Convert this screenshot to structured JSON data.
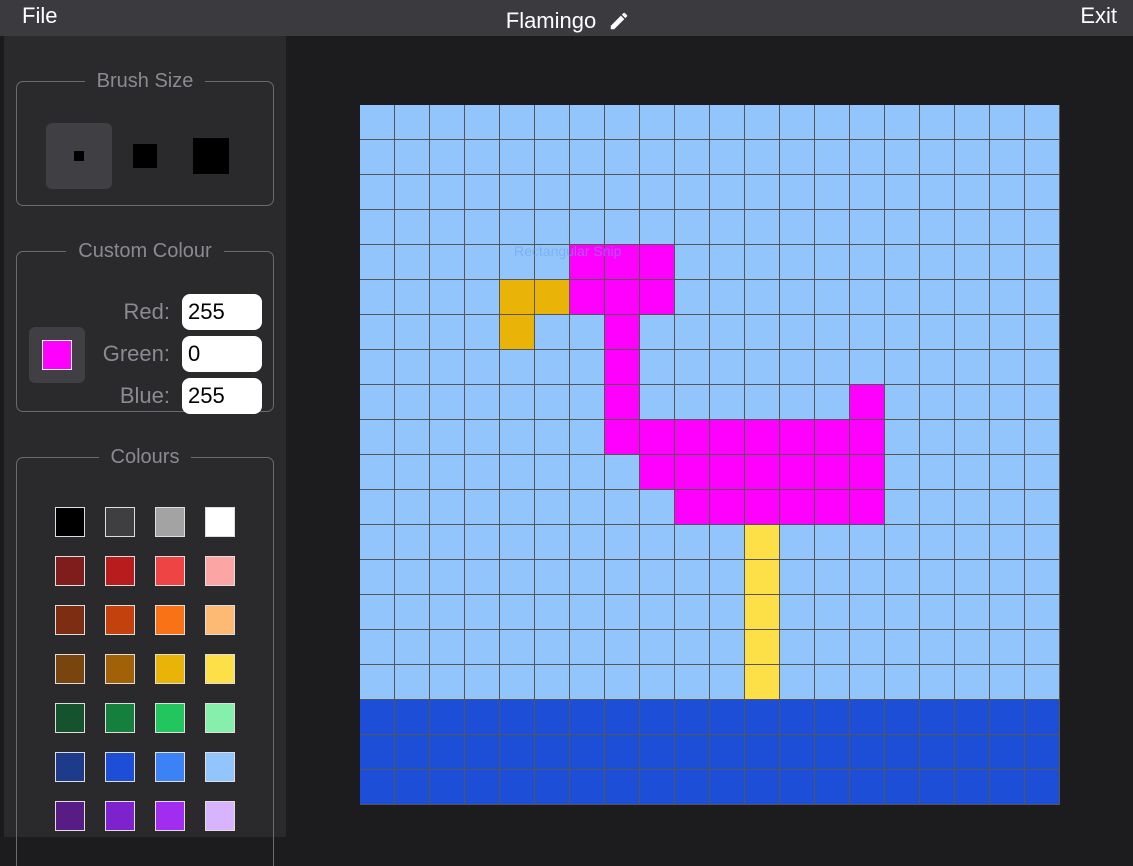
{
  "topbar": {
    "file_label": "File",
    "exit_label": "Exit",
    "title": "Flamingo",
    "edit_icon": "pencil-icon"
  },
  "brush": {
    "legend": "Brush Size",
    "sizes": [
      {
        "name": "small",
        "active": true
      },
      {
        "name": "medium",
        "active": false
      },
      {
        "name": "large",
        "active": false
      }
    ]
  },
  "custom_colour": {
    "legend": "Custom Colour",
    "red_label": "Red:",
    "red_value": "255",
    "green_label": "Green:",
    "green_value": "0",
    "blue_label": "Blue:",
    "blue_value": "255",
    "preview_color": "#ff00ff"
  },
  "colours": {
    "legend": "Colours",
    "rows": [
      [
        "#000000",
        "#3f3f42",
        "#a3a3a3",
        "#ffffff"
      ],
      [
        "#7f1d1d",
        "#b91c1c",
        "#ef4444",
        "#fca5a5"
      ],
      [
        "#7c2d12",
        "#c2410c",
        "#f97316",
        "#fdba74"
      ],
      [
        "#78450f",
        "#a16207",
        "#eab308",
        "#fde047"
      ],
      [
        "#14532d",
        "#15803d",
        "#22c55e",
        "#86efac"
      ],
      [
        "#1e3a8a",
        "#1d4ed8",
        "#3b82f6",
        "#93c5fd"
      ],
      [
        "#581c87",
        "#7e22ce",
        "#a22cf0",
        "#d8b4fe"
      ]
    ]
  },
  "canvas": {
    "tooltip": "Rectangular Snip",
    "palette": {
      "S": "#93c5fd",
      "W": "#1d4ed8",
      "M": "#ff00ff",
      "O": "#eab308",
      "Y": "#fde047"
    },
    "rows": [
      "SSSSSSSSSSSSSSSSSSSS",
      "SSSSSSSSSSSSSSSSSSSS",
      "SSSSSSSSSSSSSSSSSSSS",
      "SSSSSSSSSSSSSSSSSSSS",
      "SSSSSSMMMSSSSSSSSSSS",
      "SSSSOOMMMSSSSSSSSSSS",
      "SSSSOSSMSSSSSSSSSSSS",
      "SSSSSSSMSSSSSSSSSSSS",
      "SSSSSSSMSSSSSSMSSSSS",
      "SSSSSSSMMMMMMMMSSSSS",
      "SSSSSSSSMMMMMMMSSSSS",
      "SSSSSSSSSMMMMMMSSSSS",
      "SSSSSSSSSSSYSSSSSSSS",
      "SSSSSSSSSSSYSSSSSSSS",
      "SSSSSSSSSSSYSSSSSSSS",
      "SSSSSSSSSSSYSSSSSSSS",
      "SSSSSSSSSSSYSSSSSSSS",
      "WWWWWWWWWWWWWWWWWWWW",
      "WWWWWWWWWWWWWWWWWWWW",
      "WWWWWWWWWWWWWWWWWWWW"
    ]
  }
}
